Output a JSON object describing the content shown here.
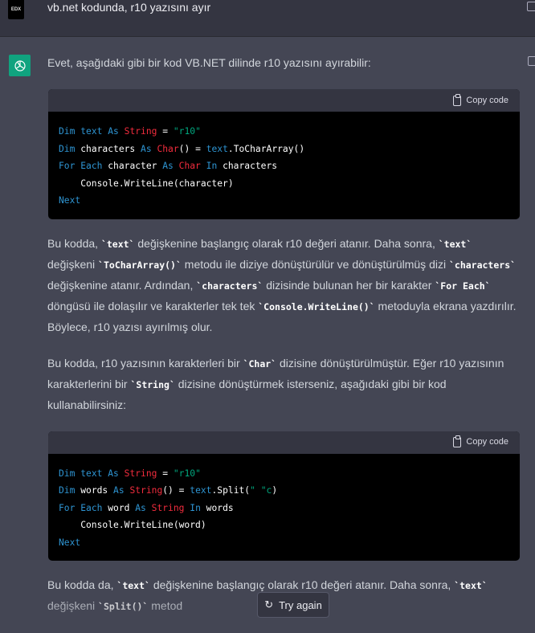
{
  "user_message": {
    "avatar_text": "EDX",
    "text": "vb.net kodunda, r10 yazısını ayır"
  },
  "assistant": {
    "intro": "Evet, aşağıdaki gibi bir kod VB.NET dilinde r10 yazısını ayırabilir:",
    "copy_label": "Copy code",
    "code_blocks": [
      [
        [
          [
            "Dim ",
            "kw"
          ],
          [
            "text ",
            "kw"
          ],
          [
            "As ",
            "kw"
          ],
          [
            "String",
            "ty"
          ],
          [
            " = ",
            "pl"
          ],
          [
            "\"r10\"",
            "st"
          ]
        ],
        [
          [
            "Dim ",
            "kw"
          ],
          [
            "characters ",
            "pl"
          ],
          [
            "As ",
            "kw"
          ],
          [
            "Char",
            "ty"
          ],
          [
            "() = ",
            "pl"
          ],
          [
            "text",
            "kw"
          ],
          [
            ".ToCharArray()",
            "pl"
          ]
        ],
        [
          [
            "For ",
            "kw"
          ],
          [
            "Each ",
            "kw"
          ],
          [
            "character ",
            "pl"
          ],
          [
            "As ",
            "kw"
          ],
          [
            "Char ",
            "ty"
          ],
          [
            "In ",
            "kw"
          ],
          [
            "characters",
            "pl"
          ]
        ],
        [
          [
            "    Console.WriteLine(character)",
            "pl"
          ]
        ],
        [
          [
            "Next",
            "kw"
          ]
        ]
      ],
      [
        [
          [
            "Dim ",
            "kw"
          ],
          [
            "text ",
            "kw"
          ],
          [
            "As ",
            "kw"
          ],
          [
            "String",
            "ty"
          ],
          [
            " = ",
            "pl"
          ],
          [
            "\"r10\"",
            "st"
          ]
        ],
        [
          [
            "Dim ",
            "kw"
          ],
          [
            "words ",
            "pl"
          ],
          [
            "As ",
            "kw"
          ],
          [
            "String",
            "ty"
          ],
          [
            "() = ",
            "pl"
          ],
          [
            "text",
            "kw"
          ],
          [
            ".Split(",
            "pl"
          ],
          [
            "\" \"c",
            "st"
          ],
          [
            ")",
            "pl"
          ]
        ],
        [
          [
            "For ",
            "kw"
          ],
          [
            "Each ",
            "kw"
          ],
          [
            "word ",
            "pl"
          ],
          [
            "As ",
            "kw"
          ],
          [
            "String ",
            "ty"
          ],
          [
            "In ",
            "kw"
          ],
          [
            "words",
            "pl"
          ]
        ],
        [
          [
            "    Console.WriteLine(word)",
            "pl"
          ]
        ],
        [
          [
            "Next",
            "kw"
          ]
        ]
      ]
    ],
    "paragraphs": [
      [
        [
          "Bu kodda, ",
          0
        ],
        [
          "`text`",
          1
        ],
        [
          " değişkenine başlangıç olarak r10 değeri atanır. Daha sonra, ",
          0
        ],
        [
          "`text`",
          1
        ],
        [
          " değişkeni ",
          0
        ],
        [
          "`ToCharArray()`",
          1
        ],
        [
          " metodu ile diziye dönüştürülür ve dönüştürülmüş dizi ",
          0
        ],
        [
          "`characters`",
          1
        ],
        [
          " değişkenine atanır. Ardından, ",
          0
        ],
        [
          "`characters`",
          1
        ],
        [
          " dizisinde bulunan her bir karakter ",
          0
        ],
        [
          "`For Each`",
          1
        ],
        [
          " döngüsü ile dolaşılır ve karakterler tek tek ",
          0
        ],
        [
          "`Console.WriteLine()`",
          1
        ],
        [
          " metoduyla ekrana yazdırılır. Böylece, r10 yazısı ayırılmış olur.",
          0
        ]
      ],
      [
        [
          "Bu kodda, r10 yazısının karakterleri bir ",
          0
        ],
        [
          "`Char`",
          1
        ],
        [
          " dizisine dönüştürülmüştür. Eğer r10 yazısının karakterlerini bir ",
          0
        ],
        [
          "`String`",
          1
        ],
        [
          " dizisine dönüştürmek isterseniz, aşağıdaki gibi bir kod kullanabilirsiniz:",
          0
        ]
      ],
      [
        [
          "Bu kodda da, ",
          0
        ],
        [
          "`text`",
          1
        ],
        [
          " değişkenine başlangıç olarak r10 değeri atanır. Daha sonra, ",
          0
        ],
        [
          "`text`",
          1
        ],
        [
          " değişkeni ",
          0
        ],
        [
          "`Split()`",
          1
        ],
        [
          " metod",
          0
        ]
      ]
    ]
  },
  "try_again_label": "Try again"
}
